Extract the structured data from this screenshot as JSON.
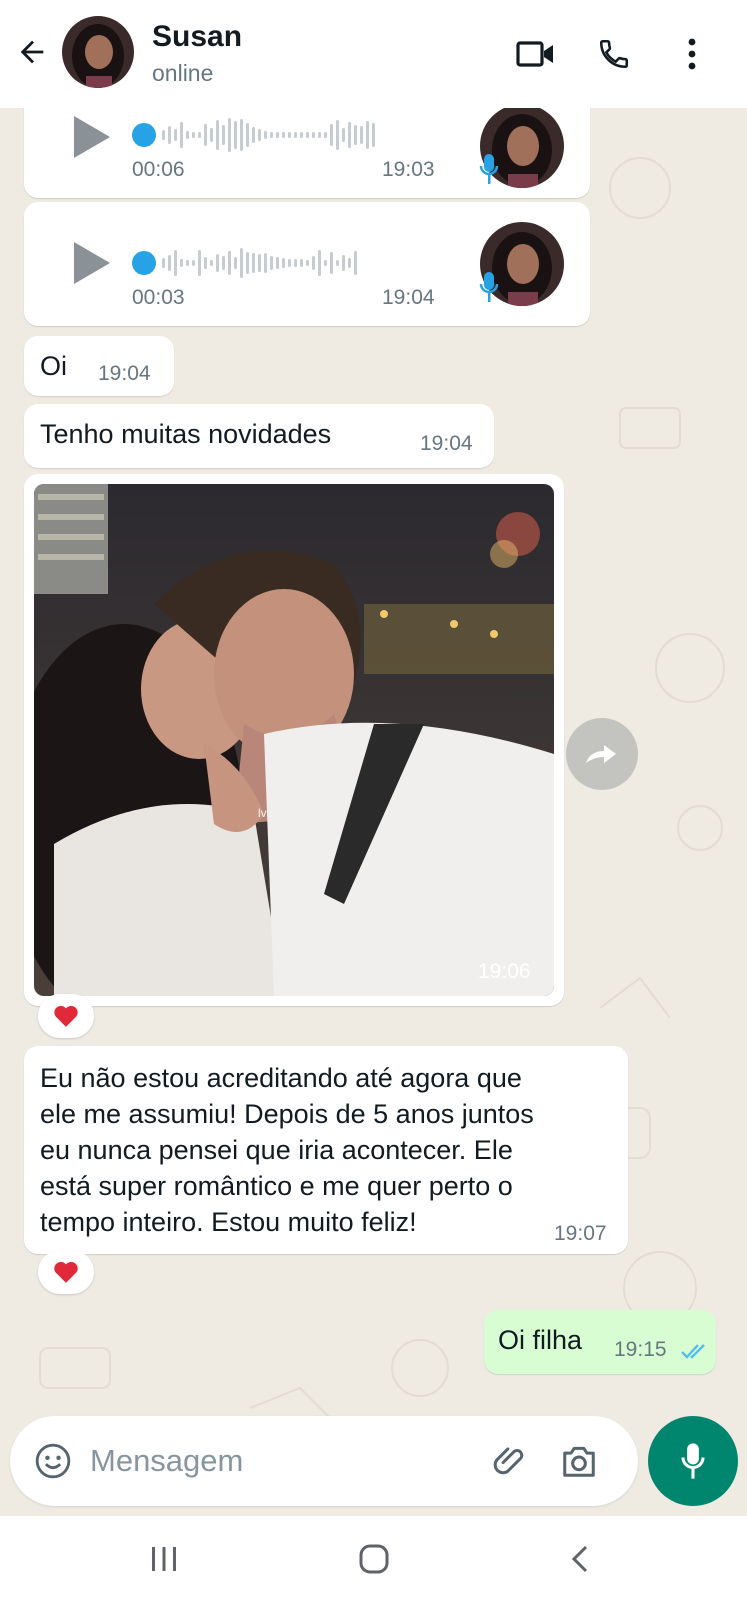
{
  "header": {
    "contact_name": "Susan",
    "status": "online",
    "icons": [
      "back-arrow-icon",
      "video-call-icon",
      "phone-icon",
      "more-options-icon"
    ]
  },
  "messages": [
    {
      "type": "voice",
      "duration": "00:06",
      "time": "19:03",
      "progress": 0
    },
    {
      "type": "voice",
      "duration": "00:03",
      "time": "19:04",
      "progress": 0
    },
    {
      "type": "text",
      "text": "Oi",
      "time": "19:04"
    },
    {
      "type": "text",
      "text": "Tenho muitas novidades",
      "time": "19:04"
    },
    {
      "type": "image",
      "watermark": "lvs",
      "time": "19:06",
      "reaction": "heart"
    },
    {
      "type": "text",
      "lines": [
        "Eu não estou acreditando até agora que",
        "ele me assumiu! Depois de 5 anos juntos",
        "eu nunca pensei que iria acontecer. Ele",
        "está super romântico e me quer perto o",
        "tempo inteiro. Estou muito feliz!"
      ],
      "time": "19:07",
      "reaction": "heart"
    },
    {
      "type": "text",
      "direction": "outgoing",
      "text": "Oi filha",
      "time": "19:15",
      "status": "read"
    }
  ],
  "composer": {
    "placeholder": "Mensagem",
    "icons": [
      "emoji-icon",
      "attach-icon",
      "camera-icon",
      "microphone-icon"
    ]
  },
  "colors": {
    "chat_background": "#efeae2",
    "incoming_bubble": "#ffffff",
    "outgoing_bubble": "#d9fdd3",
    "accent_green": "#00866f",
    "voice_dot": "#27a2e4",
    "read_ticks": "#53bdeb"
  }
}
